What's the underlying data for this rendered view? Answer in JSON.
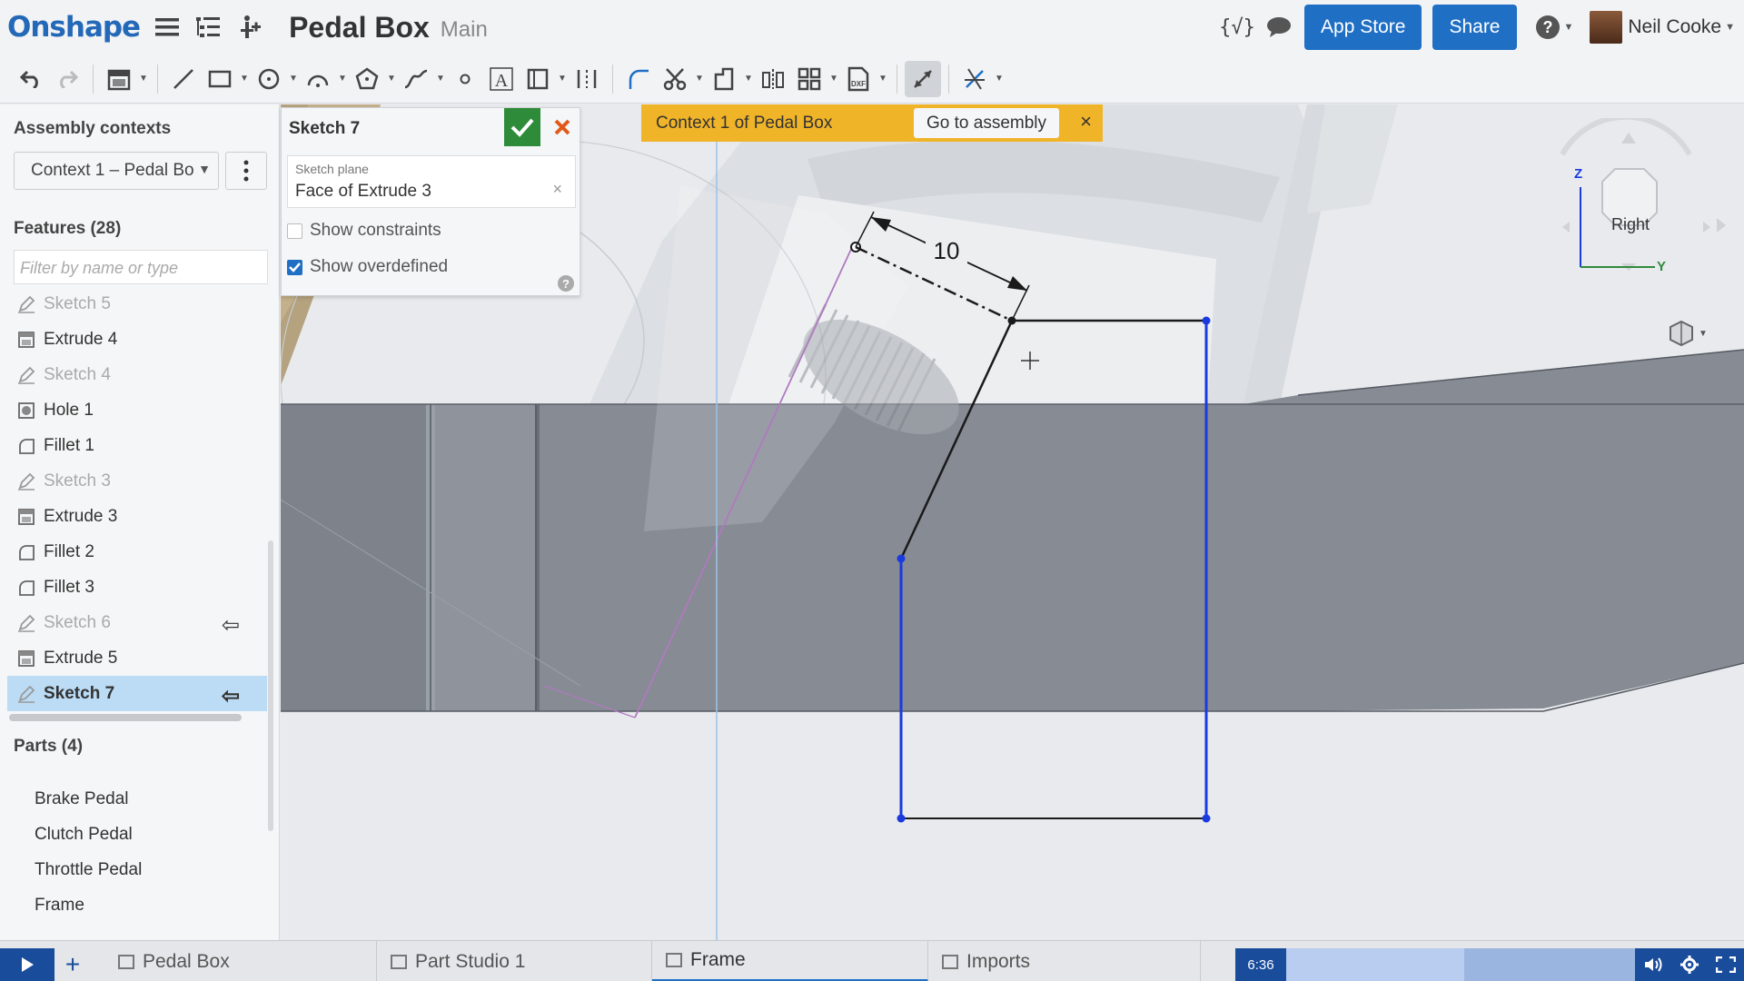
{
  "app": {
    "logo": "Onshape",
    "document_title": "Pedal Box",
    "branch": "Main"
  },
  "header": {
    "app_store_label": "App Store",
    "share_label": "Share",
    "user_name": "Neil Cooke"
  },
  "assembly_contexts": {
    "title": "Assembly contexts",
    "selected": "Context 1 – Pedal Bo"
  },
  "features": {
    "title": "Features (28)",
    "filter_placeholder": "Filter by name or type",
    "items": [
      {
        "label": "Sketch 5",
        "type": "sketch",
        "dim": true
      },
      {
        "label": "Extrude 4",
        "type": "extrude",
        "dim": false
      },
      {
        "label": "Sketch 4",
        "type": "sketch",
        "dim": true
      },
      {
        "label": "Hole 1",
        "type": "hole",
        "dim": false
      },
      {
        "label": "Fillet 1",
        "type": "fillet",
        "dim": false
      },
      {
        "label": "Sketch 3",
        "type": "sketch",
        "dim": true
      },
      {
        "label": "Extrude 3",
        "type": "extrude",
        "dim": false
      },
      {
        "label": "Fillet 2",
        "type": "fillet",
        "dim": false
      },
      {
        "label": "Fillet 3",
        "type": "fillet",
        "dim": false
      },
      {
        "label": "Sketch 6",
        "type": "sketch",
        "dim": true
      },
      {
        "label": "Extrude 5",
        "type": "extrude",
        "dim": false
      },
      {
        "label": "Sketch 7",
        "type": "sketch",
        "dim": false
      }
    ]
  },
  "parts": {
    "title": "Parts (4)",
    "items": [
      "Brake Pedal",
      "Clutch Pedal",
      "Throttle Pedal",
      "Frame"
    ]
  },
  "sketch_dialog": {
    "title": "Sketch 7",
    "plane_label": "Sketch plane",
    "plane_value": "Face of Extrude 3",
    "show_constraints_label": "Show constraints",
    "show_constraints": false,
    "show_overdefined_label": "Show overdefined",
    "show_overdefined": true
  },
  "context_banner": {
    "text": "Context 1 of Pedal Box",
    "goto_label": "Go to assembly"
  },
  "viewport": {
    "dimension_value": "10",
    "view_label": "Right",
    "axis_z": "Z",
    "axis_y": "Y"
  },
  "tabs": [
    {
      "label": "Pedal Box",
      "icon": "assembly-icon"
    },
    {
      "label": "Part Studio 1",
      "icon": "part-studio-icon"
    },
    {
      "label": "Frame",
      "icon": "part-studio-icon",
      "active": true
    },
    {
      "label": "Imports",
      "icon": "folder-icon"
    }
  ],
  "player": {
    "timecode": "6:36",
    "progress": 0.51
  },
  "colors": {
    "brand": "#2468b8",
    "accent": "#1f6fc5",
    "banner": "#f0b429",
    "confirm": "#2e8b3a",
    "cancel": "#e05a1a",
    "sketch_line": "#1a3ae0"
  }
}
